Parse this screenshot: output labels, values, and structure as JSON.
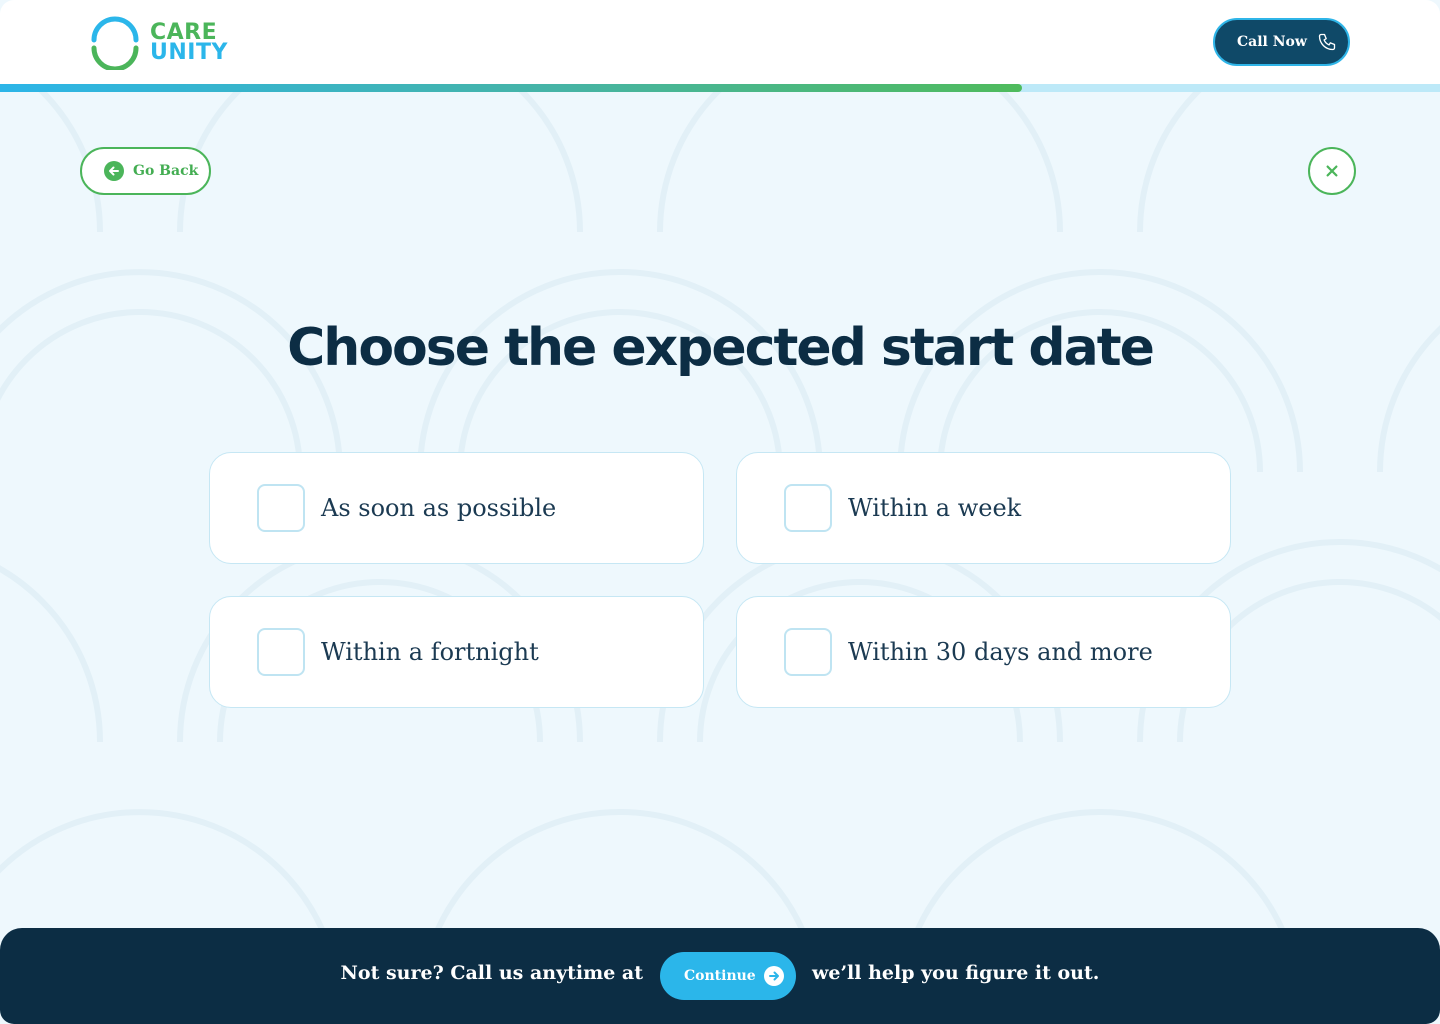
{
  "brand": {
    "name_line1": "CARE",
    "name_line2": "UNITY",
    "colors": {
      "green": "#4bb55a",
      "blue": "#2bb6ea",
      "navy": "#0c2d44"
    }
  },
  "header": {
    "call_button_label": "Call Now",
    "call_icon": "phone-icon"
  },
  "progress": {
    "value": 0.71
  },
  "nav": {
    "back_label": "Go Back",
    "back_icon": "arrow-left-icon",
    "close_icon": "close-icon"
  },
  "question": {
    "title": "Choose the expected start date",
    "options": [
      {
        "label": "As soon as possible",
        "checked": false
      },
      {
        "label": "Within a week",
        "checked": false
      },
      {
        "label": "Within a fortnight",
        "checked": false
      },
      {
        "label": "Within 30 days and more",
        "checked": false
      }
    ]
  },
  "footer": {
    "text_before": "Not sure? Call us anytime at",
    "button_label": "Continue",
    "button_icon": "arrow-right-icon",
    "text_after": "we’ll help you figure it out."
  }
}
